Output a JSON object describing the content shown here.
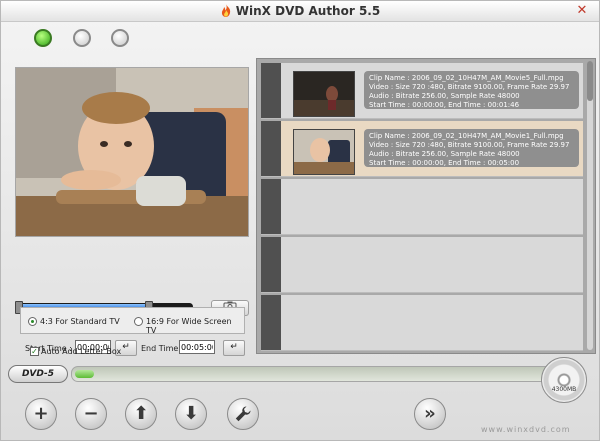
{
  "window": {
    "title": "WinX DVD Author 5.5",
    "close_glyph": "✕"
  },
  "icons": {
    "app_flame": "flame-icon",
    "status_lights": [
      "status-light-active",
      "status-light-idle",
      "status-light-idle"
    ],
    "snapshot": "camera-icon",
    "enter": "↵",
    "add": "+",
    "remove": "−",
    "up": "⬆",
    "down": "⬇",
    "settings": "wrench-icon",
    "next": "»"
  },
  "preview": {
    "seek_fraction": 0.75
  },
  "trim": {
    "start_label": "Start Time :",
    "start_value": "00:00:00",
    "end_label": "End Time :",
    "end_value": "00:05:00"
  },
  "aspect": {
    "option_43": "4:3 For Standard TV",
    "option_169": "16:9 For Wide Screen TV",
    "selected": "4:3"
  },
  "letterbox": {
    "label": "Auto Add Letter Box",
    "checked": true
  },
  "clips": [
    {
      "clip_name": "Clip Name : 2006_09_02_10H47M_AM_Movie5_Full.mpg",
      "video": "Video : Size 720 :480, Bitrate 9100.00, Frame Rate 29.97",
      "audio": "Audio : Bitrate 256.00, Sample Rate 48000",
      "time": "Start Time : 00:00:00, End Time : 00:01:46",
      "selected": false
    },
    {
      "clip_name": "Clip Name : 2006_09_02_10H47M_AM_Movie1_Full.mpg",
      "video": "Video : Size 720 :480, Bitrate 9100.00, Frame Rate 29.97",
      "audio": "Audio : Bitrate 256.00, Sample Rate 48000",
      "time": "Start Time : 00:00:00, End Time : 00:05:00",
      "selected": true
    }
  ],
  "disc": {
    "format": "DVD-5",
    "capacity": "4300MB",
    "used_fraction": 0.04
  },
  "watermark": "www.winxdvd.com",
  "colors": {
    "accent_green": "#2fa315",
    "progress_blue": "#2a74d9"
  }
}
